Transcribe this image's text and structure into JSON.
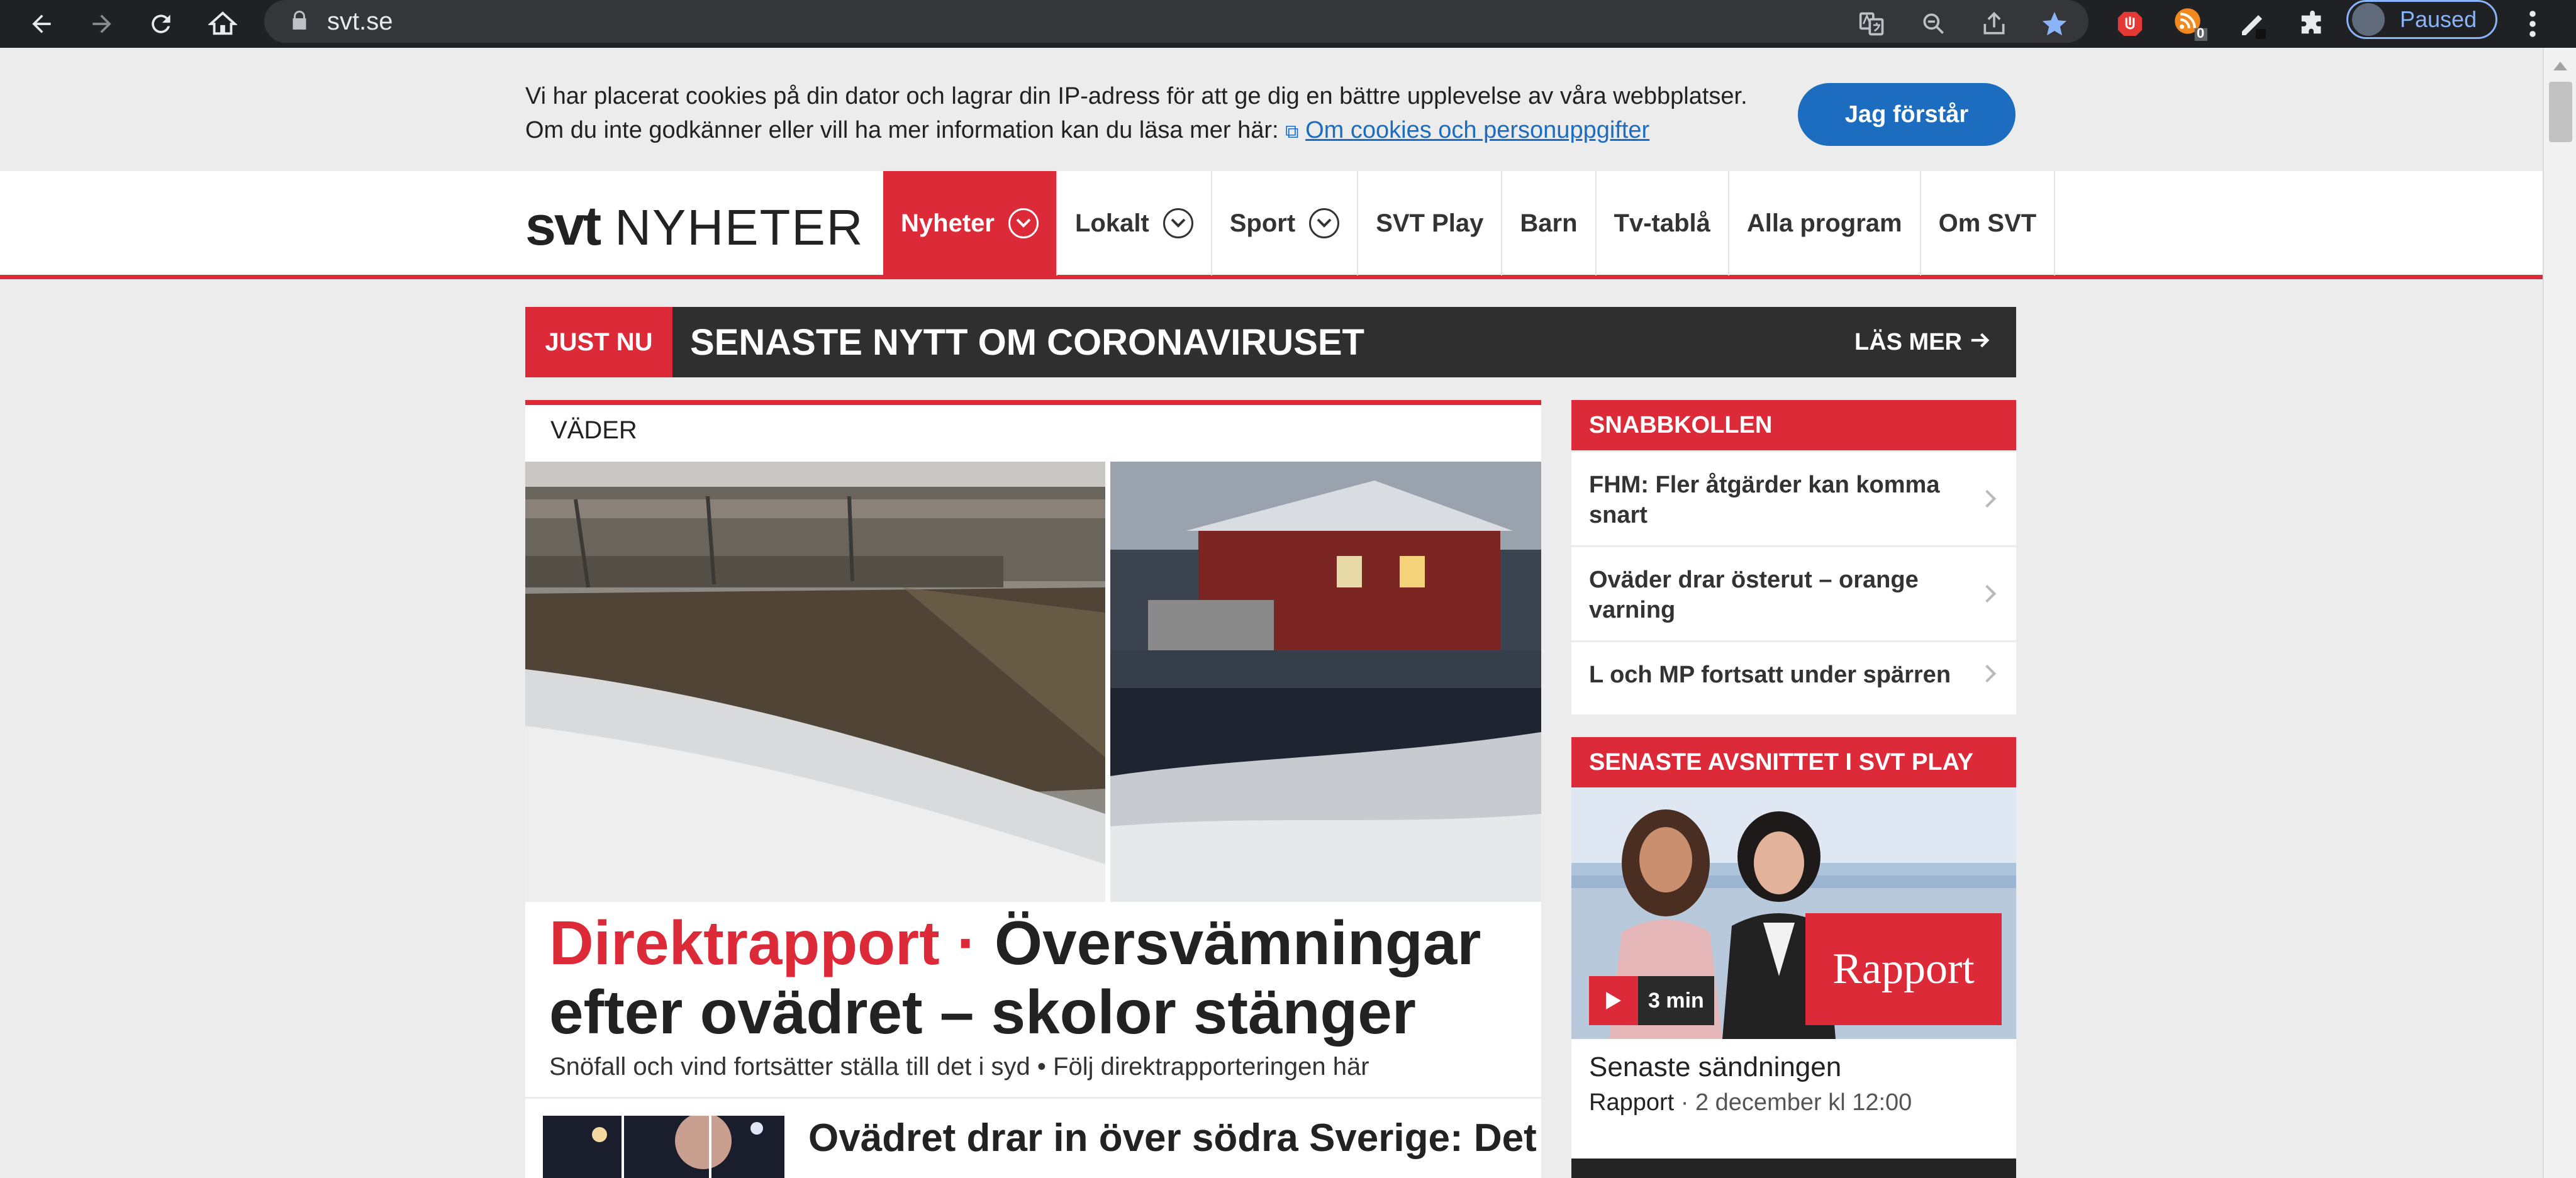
{
  "browser": {
    "url": "svt.se",
    "profile_status": "Paused",
    "extension_badge": "0"
  },
  "cookie": {
    "line1": "Vi har placerat cookies på din dator och lagrar din IP-adress för att ge dig en bättre upplevelse av våra webbplatser.",
    "line2_prefix": "Om du inte godkänner eller vill ha mer information kan du läsa mer här: ",
    "link_label": "Om cookies och personuppgifter",
    "accept_label": "Jag förstår"
  },
  "header": {
    "logo_svt": "svt",
    "logo_section": "NYHETER",
    "menu": [
      {
        "label": "Nyheter"
      },
      {
        "label": "Lokalt"
      },
      {
        "label": "Sport"
      },
      {
        "label": "SVT Play"
      },
      {
        "label": "Barn"
      },
      {
        "label": "Tv-tablå"
      },
      {
        "label": "Alla program"
      },
      {
        "label": "Om SVT"
      }
    ]
  },
  "justnu": {
    "tag": "JUST NU",
    "title": "SENASTE NYTT OM CORONAVIRUSET",
    "more": "LÄS MER"
  },
  "main": {
    "kicker": "VÄDER",
    "headline_tag": "Direktrapport ·",
    "headline": "Översvämningar efter ovädret – skolor stänger",
    "lead": "Snöfall och vind fortsätter ställa till det i syd • Följ direktrapporteringen här",
    "next_headline": "Ovädret drar in över södra Sverige: Det"
  },
  "snabbkollen": {
    "title": "SNABBKOLLEN",
    "items": [
      {
        "label": "FHM: Fler åtgärder kan komma snart"
      },
      {
        "label": "Oväder drar österut – orange varning"
      },
      {
        "label": "L och MP fortsatt under spärren"
      }
    ]
  },
  "svtplay": {
    "title": "SENASTE AVSNITTET I SVT PLAY",
    "badge": "Rapport",
    "duration": "3 min",
    "episode_title": "Senaste sändningen",
    "program": "Rapport",
    "meta": " · 2 december kl 12:00"
  },
  "colors": {
    "svt_red": "#dc2a38",
    "link_blue": "#1c6dbf",
    "dark_bar": "#2f2f2f"
  }
}
